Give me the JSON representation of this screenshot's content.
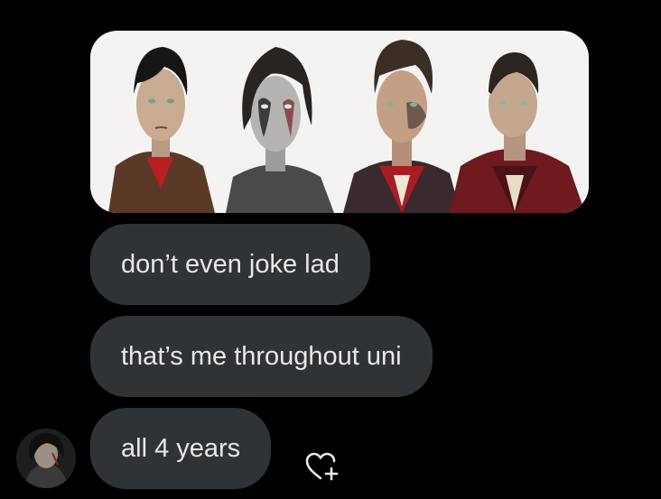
{
  "conversation": {
    "media": {
      "alt": "Four illustrated character portraits"
    },
    "messages": [
      {
        "text": "don’t even joke lad"
      },
      {
        "text": "that’s me throughout uni"
      },
      {
        "text": "all 4 years"
      }
    ],
    "sender": {
      "avatar_icon": "user-avatar"
    },
    "actions": {
      "react_icon": "add-reaction-heart-icon"
    }
  },
  "colors": {
    "background": "#000000",
    "bubble": "#2f3336",
    "bubble_text": "#e7e9ea",
    "icon": "#e7e9ea"
  }
}
